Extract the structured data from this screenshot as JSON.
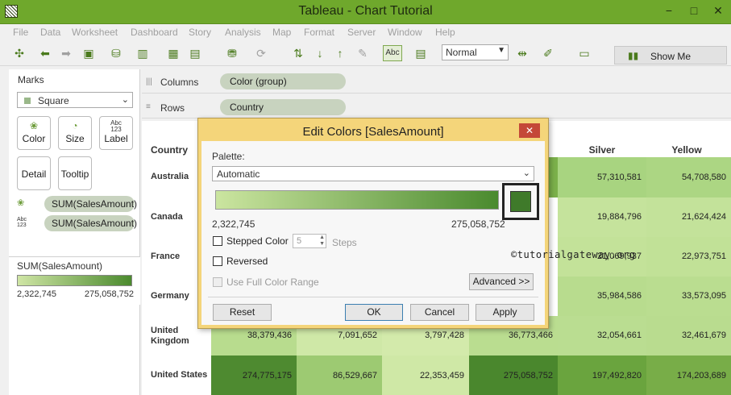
{
  "window": {
    "title": "Tableau - Chart Tutorial",
    "min": "−",
    "restore": "□",
    "close": "✕"
  },
  "menu": [
    "File",
    "Data",
    "Worksheet",
    "Dashboard",
    "Story",
    "Analysis",
    "Map",
    "Format",
    "Server",
    "Window",
    "Help"
  ],
  "toolbar": {
    "fit_value": "Normal",
    "show_me": "Show Me",
    "abc": "Abc"
  },
  "marks": {
    "title": "Marks",
    "type": "Square",
    "cards": {
      "color": "Color",
      "size": "Size",
      "label": "Label",
      "detail": "Detail",
      "tooltip": "Tooltip"
    },
    "label_icon": "Abc\n123",
    "pills": [
      "SUM(SalesAmount)",
      "SUM(SalesAmount)"
    ]
  },
  "legend": {
    "title": "SUM(SalesAmount)",
    "min": "2,322,745",
    "max": "275,058,752"
  },
  "shelves": {
    "columns_label": "Columns",
    "columns_pill": "Color (group)",
    "rows_label": "Rows",
    "rows_pill": "Country"
  },
  "table": {
    "row_header": "Country",
    "columns": [
      "Silver",
      "Yellow"
    ],
    "rows": [
      {
        "country": "Australia",
        "silver": "57,310,581",
        "yellow": "54,708,580"
      },
      {
        "country": "Canada",
        "silver": "19,884,796",
        "yellow": "21,624,424"
      },
      {
        "country": "France",
        "silver": "21,069,937",
        "yellow": "22,973,751"
      },
      {
        "country": "Germany",
        "silver": "35,984,586",
        "yellow": "33,573,095"
      },
      {
        "country": "United Kingdom",
        "silver": "32,054,661",
        "yellow": "32,461,679"
      },
      {
        "country": "United States",
        "c1": "274,775,175",
        "c2": "86,529,667",
        "c3": "22,353,459",
        "c4": "275,058,752",
        "silver": "197,492,820",
        "yellow": "174,203,689"
      }
    ],
    "uk_partial": [
      "38,379,436",
      "7,091,652",
      "3,797,428",
      "36,773,466"
    ]
  },
  "dialog": {
    "title": "Edit Colors [SalesAmount]",
    "close": "✕",
    "palette_label": "Palette:",
    "palette_value": "Automatic",
    "ramp_min": "2,322,745",
    "ramp_max": "275,058,752",
    "stepped_color": "Stepped Color",
    "steps_value": "5",
    "steps_label": "Steps",
    "reversed": "Reversed",
    "use_full_range": "Use Full Color Range",
    "advanced": "Advanced >>",
    "reset": "Reset",
    "ok": "OK",
    "cancel": "Cancel",
    "apply": "Apply"
  },
  "watermark": "©tutorialgateway.org",
  "colors": {
    "title_bar": "#6fa82c",
    "dialog_frame": "#f4d57a",
    "ramp_start": "#cbe5a0",
    "ramp_end": "#4a8a2e"
  }
}
